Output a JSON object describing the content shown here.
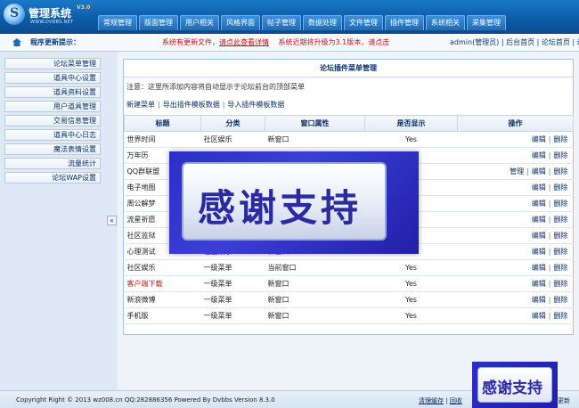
{
  "logo": {
    "title": "管理系统",
    "version": "V3.0",
    "sub": "WWW.DVBBS.NET"
  },
  "topnav": [
    "常规管理",
    "版面管理",
    "用户相关",
    "风格界面",
    "帖子管理",
    "数据处理",
    "文件管理",
    "插件管理",
    "系统相关",
    "采集管理"
  ],
  "subbar": {
    "tip_label": "程序更新提示：",
    "alert_a": "系统有更新文件，",
    "alert_link": "请点此查看详情",
    "alert_b": "系统近期将升级为3.1版本，请点击",
    "admin": "admin(管理员) | 后台首页 | 论坛首页 | 退"
  },
  "sidebar": [
    "论坛菜单管理",
    "道具中心设置",
    "道具资料设置",
    "用户道具管理",
    "交易信息管理",
    "道具中心日志",
    "魔法表情设置",
    "流量统计",
    "论坛WAP设置"
  ],
  "panel": {
    "title": "论坛插件菜单管理",
    "notice": "注意：这里所添加内容将自动显示于论坛前台的顶部菜单",
    "actions": [
      "新建菜单",
      "导出插件模板数据",
      "导入插件模板数据"
    ]
  },
  "table": {
    "headers": [
      "标题",
      "分类",
      "窗口属性",
      "是否显示",
      "操作"
    ],
    "rows": [
      {
        "name": "世界时间",
        "cat": "社区娱乐",
        "win": "新窗口",
        "show": "Yes",
        "ops": [
          "编辑",
          "删除"
        ]
      },
      {
        "name": "万年历",
        "cat": "",
        "win": "",
        "show": "",
        "ops": [
          "编辑",
          "删除"
        ]
      },
      {
        "name": "QQ群联盟",
        "cat": "",
        "win": "",
        "show": "",
        "ops": [
          "管理",
          "编辑",
          "删除"
        ]
      },
      {
        "name": "电子地图",
        "cat": "",
        "win": "",
        "show": "",
        "ops": [
          "编辑",
          "删除"
        ]
      },
      {
        "name": "周公解梦",
        "cat": "",
        "win": "",
        "show": "",
        "ops": [
          "编辑",
          "删除"
        ]
      },
      {
        "name": "流星祈愿",
        "cat": "",
        "win": "",
        "show": "",
        "ops": [
          "编辑",
          "删除"
        ]
      },
      {
        "name": "社区监狱",
        "cat": "",
        "win": "",
        "show": "",
        "ops": [
          "编辑",
          "删除"
        ]
      },
      {
        "name": "心理测试",
        "cat": "社区娱乐",
        "win": "新窗口",
        "show": "Yes",
        "ops": [
          "编辑",
          "删除"
        ]
      },
      {
        "name": "社区娱乐",
        "cat": "一级菜单",
        "win": "当前窗口",
        "show": "Yes",
        "ops": [
          "编辑",
          "删除"
        ]
      },
      {
        "name": "客户端下载",
        "cat": "一级菜单",
        "win": "新窗口",
        "show": "Yes",
        "ops": [
          "编辑",
          "删除"
        ],
        "red": true
      },
      {
        "name": "新浪微博",
        "cat": "一级菜单",
        "win": "新窗口",
        "show": "Yes",
        "ops": [
          "编辑",
          "删除"
        ]
      },
      {
        "name": "手机版",
        "cat": "一级菜单",
        "win": "新窗口",
        "show": "Yes",
        "ops": [
          "编辑",
          "删除"
        ]
      }
    ]
  },
  "overlay": {
    "big": "感谢支持",
    "small": "感谢支持"
  },
  "footer": {
    "copy": "Copyright Right © 2013 wz008.cn QQ:282886356 Powered By Dvbbs Version 8.3.0",
    "link1": "清理缓存",
    "sep": " | ",
    "link2": "回收",
    "more": "更新"
  },
  "colors": {
    "topbar": "#0d5aa5",
    "alert": "#d41010",
    "overlay": "#2b2ec8"
  }
}
